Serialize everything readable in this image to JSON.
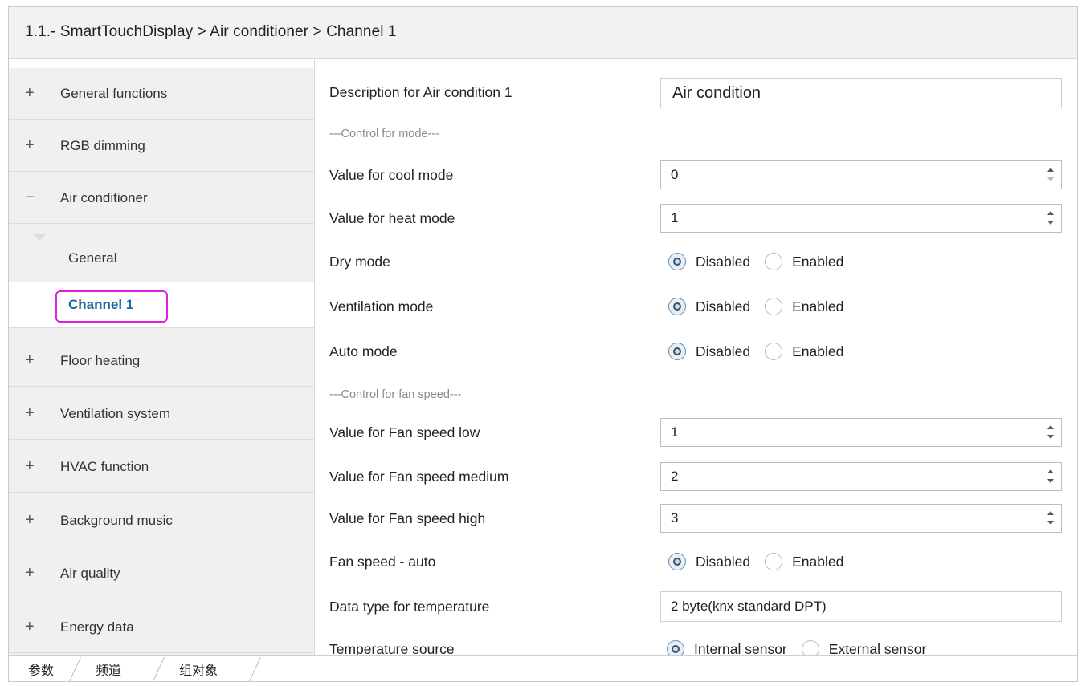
{
  "header": {
    "title": "1.1.- SmartTouchDisplay > Air conditioner > Channel 1"
  },
  "sidebar": {
    "groups": [
      {
        "sign": "+",
        "label": "General functions"
      },
      {
        "sign": "+",
        "label": "RGB dimming"
      },
      {
        "sign": "−",
        "label": "Air conditioner"
      },
      {
        "sign": "+",
        "label": "Floor heating"
      },
      {
        "sign": "+",
        "label": "Ventilation system"
      },
      {
        "sign": "+",
        "label": "HVAC function"
      },
      {
        "sign": "+",
        "label": "Background music"
      },
      {
        "sign": "+",
        "label": "Air quality"
      },
      {
        "sign": "+",
        "label": "Energy data"
      }
    ],
    "subitems": [
      {
        "label": "General"
      },
      {
        "label": "Channel 1"
      }
    ]
  },
  "content": {
    "description": {
      "label": "Description for Air condition 1",
      "value": "Air condition"
    },
    "section_mode": "---Control for mode---",
    "cool_mode": {
      "label": "Value for cool mode",
      "value": "0"
    },
    "heat_mode": {
      "label": "Value for heat mode",
      "value": "1"
    },
    "dry_mode": {
      "label": "Dry mode",
      "opt1": "Disabled",
      "opt2": "Enabled",
      "selected": "Disabled"
    },
    "ventilation_mode": {
      "label": "Ventilation mode",
      "opt1": "Disabled",
      "opt2": "Enabled",
      "selected": "Disabled"
    },
    "auto_mode": {
      "label": "Auto mode",
      "opt1": "Disabled",
      "opt2": "Enabled",
      "selected": "Disabled"
    },
    "section_fan": "---Control for fan speed---",
    "fan_low": {
      "label": "Value for Fan speed low",
      "value": "1"
    },
    "fan_medium": {
      "label": "Value for Fan speed medium",
      "value": "2"
    },
    "fan_high": {
      "label": "Value for Fan speed high",
      "value": "3"
    },
    "fan_auto": {
      "label": "Fan speed - auto",
      "opt1": "Disabled",
      "opt2": "Enabled",
      "selected": "Disabled"
    },
    "data_type": {
      "label": "Data type for temperature",
      "value": "2 byte(knx standard DPT)"
    },
    "temp_source": {
      "label": "Temperature source",
      "opt1": "Internal sensor",
      "opt2": "External sensor",
      "selected": "Internal sensor"
    }
  },
  "tabs": [
    {
      "label": "参数"
    },
    {
      "label": "频道"
    },
    {
      "label": "组对象"
    }
  ],
  "colors": {
    "accent": "#1c6a9e",
    "highlight": "#e020e0"
  }
}
